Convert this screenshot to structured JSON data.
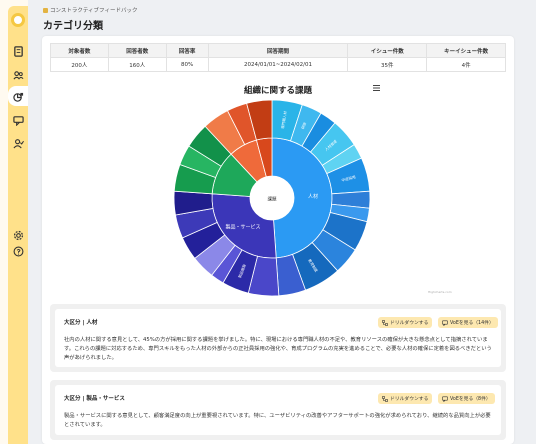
{
  "breadcrumb": "コンストラクティブフィードバック",
  "page_title": "カテゴリ分類",
  "stats": {
    "headers": [
      "対象者数",
      "回答者数",
      "回答率",
      "回答期間",
      "イシュー件数",
      "キーイシュー件数"
    ],
    "values": [
      "200人",
      "160人",
      "80%",
      "2024/01/01~2024/02/01",
      "35件",
      "4件"
    ]
  },
  "chart": {
    "title": "組織に関する課題",
    "menu_icon": "hamburger-icon",
    "center_label": "課題"
  },
  "sunburst": {
    "inner": [
      {
        "label": "人材",
        "start": 0,
        "end": 176,
        "color": "#2b9af3"
      },
      {
        "label": "製品・サービス",
        "start": 176,
        "end": 274,
        "color": "#3b36b8"
      },
      {
        "label": "",
        "start": 274,
        "end": 317,
        "color": "#1ea85a"
      },
      {
        "label": "",
        "start": 317,
        "end": 345,
        "color": "#ef6a3a"
      },
      {
        "label": "",
        "start": 345,
        "end": 360,
        "color": "#d8481c"
      }
    ],
    "outer": [
      {
        "label": "専門職人材",
        "start": 0,
        "end": 18,
        "color": "#2ab4e8"
      },
      {
        "label": "研修",
        "start": 18,
        "end": 30,
        "color": "#3fb8ef"
      },
      {
        "label": "",
        "start": 30,
        "end": 40,
        "color": "#1a8de0"
      },
      {
        "label": "人材育成",
        "start": 40,
        "end": 57,
        "color": "#46c6f0"
      },
      {
        "label": "",
        "start": 57,
        "end": 66,
        "color": "#5fd3f2"
      },
      {
        "label": "中途採用",
        "start": 66,
        "end": 86,
        "color": "#1e90e6"
      },
      {
        "label": "",
        "start": 86,
        "end": 96,
        "color": "#2e7fd8"
      },
      {
        "label": "",
        "start": 96,
        "end": 104,
        "color": "#3a99ee"
      },
      {
        "label": "",
        "start": 104,
        "end": 122,
        "color": "#1c73c9"
      },
      {
        "label": "",
        "start": 122,
        "end": 138,
        "color": "#2b84dd"
      },
      {
        "label": "教育制度",
        "start": 138,
        "end": 160,
        "color": "#1569bd"
      },
      {
        "label": "",
        "start": 160,
        "end": 176,
        "color": "#3a5fd0"
      },
      {
        "label": "",
        "start": 176,
        "end": 194,
        "color": "#4a47c9"
      },
      {
        "label": "製品開発",
        "start": 194,
        "end": 210,
        "color": "#2c2aa8"
      },
      {
        "label": "",
        "start": 210,
        "end": 218,
        "color": "#5a55d6"
      },
      {
        "label": "",
        "start": 218,
        "end": 232,
        "color": "#8b88e8"
      },
      {
        "label": "",
        "start": 232,
        "end": 246,
        "color": "#23209a"
      },
      {
        "label": "",
        "start": 246,
        "end": 260,
        "color": "#3d3ab8"
      },
      {
        "label": "",
        "start": 260,
        "end": 274,
        "color": "#201d8c"
      },
      {
        "label": "",
        "start": 274,
        "end": 290,
        "color": "#169c4e"
      },
      {
        "label": "",
        "start": 290,
        "end": 302,
        "color": "#27b562"
      },
      {
        "label": "",
        "start": 302,
        "end": 317,
        "color": "#12914a"
      },
      {
        "label": "",
        "start": 317,
        "end": 333,
        "color": "#f07b48"
      },
      {
        "label": "",
        "start": 333,
        "end": 345,
        "color": "#e0552a"
      },
      {
        "label": "",
        "start": 345,
        "end": 360,
        "color": "#c23d14"
      }
    ]
  },
  "sections": [
    {
      "title": "大区分 | 人材",
      "drill_label": "ドリルダウンする",
      "voice_label": "VoEを見る（14件）",
      "body": "社内の人材に関する意見として、45%の方が採用に関する課題を挙げました。特に、現場における専門職人材の不足や、教育リソースの確保が大きな懸念点として指摘されています。これらの課題に対応するため、専門スキルをもった人材の外部からの正社員採用の強化や、育成プログラムの充実を進めることで、必要な人材の確保に定着を図るべきだという声があげられました。"
    },
    {
      "title": "大区分 | 製品・サービス",
      "drill_label": "ドリルダウンする",
      "voice_label": "VoEを見る（8件）",
      "body": "製品・サービスに関する意見として、顧客満足度の向上が重要視されています。特に、ユーザビリティの改善やアフターサポートの強化が求められており、継続的な品質向上が必要とされています。"
    }
  ],
  "credit": "Highcharts.com"
}
